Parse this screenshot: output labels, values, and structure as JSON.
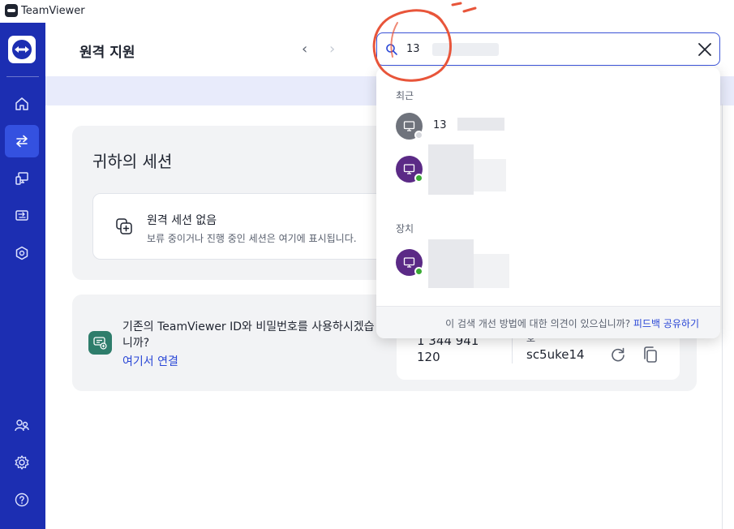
{
  "app": {
    "name": "TeamViewer",
    "accent": "#1c2eb2",
    "active_nav": "#3451e0"
  },
  "sidebar": {
    "items": [
      {
        "name": "home",
        "icon": "home-icon",
        "active": false
      },
      {
        "name": "remote-support",
        "icon": "swap-arrows-icon",
        "active": true
      },
      {
        "name": "remote-management",
        "icon": "monitor-device-icon",
        "active": false
      },
      {
        "name": "file-transfer",
        "icon": "transfer-screen-icon",
        "active": false
      },
      {
        "name": "security",
        "icon": "hexagon-shield-icon",
        "active": false
      }
    ],
    "bottom_items": [
      {
        "name": "contacts",
        "icon": "people-icon"
      },
      {
        "name": "settings",
        "icon": "gear-icon"
      },
      {
        "name": "help",
        "icon": "help-icon"
      }
    ]
  },
  "header": {
    "title": "원격 지원"
  },
  "search": {
    "value": "13"
  },
  "dropdown": {
    "recent_label": "최근",
    "recent": [
      {
        "name": "13",
        "status": "offline"
      },
      {
        "name": "",
        "status": "online"
      }
    ],
    "devices_label": "장치",
    "devices": [
      {
        "name": "",
        "status": "online"
      }
    ],
    "feedback_question": "이 검색 개선 방법에 대한 의견이 있으십니까? ",
    "feedback_link": "피드백 공유하기"
  },
  "sessions": {
    "title": "귀하의 세션",
    "empty_title": "원격 세션 없음",
    "empty_desc": "보류 중이거나 진행 중인 세션은 여기에 표시됩니다."
  },
  "id_card": {
    "question": "기존의 TeamViewer ID와 비밀번호를 사용하시겠습니까?",
    "link": "여기서 연결",
    "id_value": "1 344 941\n120",
    "password_label": "호",
    "password": "sc5uke14"
  }
}
